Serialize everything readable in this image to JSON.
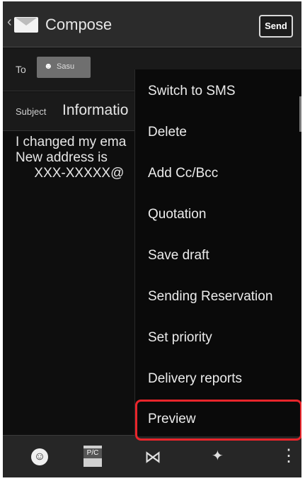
{
  "header": {
    "title": "Compose",
    "send_label": "Send"
  },
  "to": {
    "label": "To",
    "recipient": "Sasu"
  },
  "subject": {
    "label": "Subject",
    "value": "Informatio"
  },
  "body": {
    "text": "I changed my ema\nNew address is\n     XXX-XXXXX@"
  },
  "menu": {
    "items": [
      "Switch to SMS",
      "Delete",
      "Add Cc/Bcc",
      "Quotation",
      "Save draft",
      "Sending Reservation",
      "Set priority",
      "Delivery reports",
      "Preview"
    ],
    "highlighted_item": "Preview",
    "highlight_color": "#e8252b"
  },
  "toolbar": {
    "icons": [
      "smiley-icon",
      "template-icon",
      "attach-icon",
      "sparkle-icon",
      "more-icon"
    ],
    "template_label": "P/C"
  }
}
